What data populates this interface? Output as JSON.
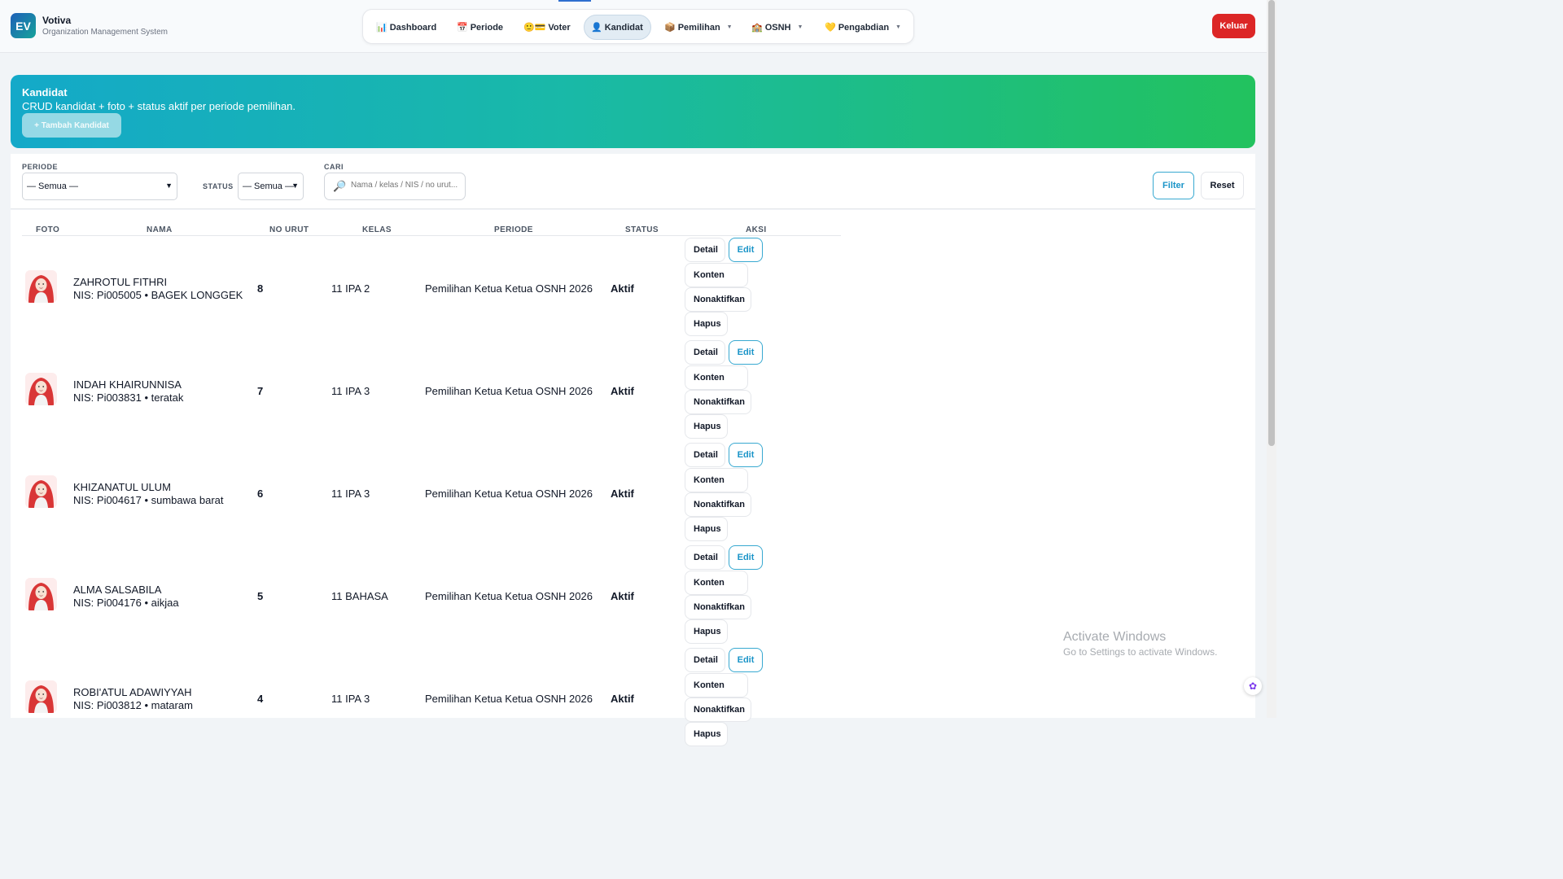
{
  "app": {
    "logo": "EV",
    "name": "Votiva",
    "subtitle": "Organization Management System"
  },
  "nav": [
    {
      "icon": "📊",
      "label": "Dashboard"
    },
    {
      "icon": "📅",
      "label": "Periode"
    },
    {
      "icon": "🙂💳",
      "label": "Voter"
    },
    {
      "icon": "👤",
      "label": "Kandidat",
      "active": true
    },
    {
      "icon": "📦",
      "label": "Pemilihan",
      "caret": "▼"
    },
    {
      "icon": "🏫",
      "label": "OSNH",
      "caret": "▼"
    },
    {
      "icon": "💛",
      "label": "Pengabdian",
      "caret": "▼"
    }
  ],
  "logout_label": "Keluar",
  "banner": {
    "title": "Kandidat",
    "subtitle": "CRUD kandidat + foto + status aktif per periode pemilihan.",
    "add_button": "+ Tambah Kandidat"
  },
  "filters": {
    "periode_label": "PERIODE",
    "periode_value": "— Semua —",
    "status_label": "STATUS",
    "status_value": "— Semua —",
    "search_label": "CARI",
    "search_placeholder": "Nama / kelas / NIS / no urut...",
    "filter_button": "Filter",
    "reset_button": "Reset"
  },
  "table": {
    "headers": [
      "FOTO",
      "NAMA",
      "NO URUT",
      "KELAS",
      "PERIODE",
      "STATUS",
      "AKSI"
    ],
    "actions": {
      "detail": "Detail",
      "edit": "Edit",
      "konten": "Konten",
      "nonaktifkan": "Nonaktifkan",
      "hapus": "Hapus"
    },
    "rows": [
      {
        "name": "ZAHROTUL FITHRI",
        "nis": "NIS: Pi005005 • BAGEK LONGGEK",
        "no": "8",
        "kelas": "11 IPA 2",
        "periode": "Pemilihan Ketua Ketua OSNH 2026",
        "status": "Aktif"
      },
      {
        "name": "INDAH KHAIRUNNISA",
        "nis": "NIS: Pi003831 • teratak",
        "no": "7",
        "kelas": "11 IPA 3",
        "periode": "Pemilihan Ketua Ketua OSNH 2026",
        "status": "Aktif"
      },
      {
        "name": "KHIZANATUL ULUM",
        "nis": "NIS: Pi004617 • sumbawa barat",
        "no": "6",
        "kelas": "11 IPA 3",
        "periode": "Pemilihan Ketua Ketua OSNH 2026",
        "status": "Aktif"
      },
      {
        "name": "ALMA SALSABILA",
        "nis": "NIS: Pi004176 • aikjaa",
        "no": "5",
        "kelas": "11 BAHASA",
        "periode": "Pemilihan Ketua Ketua OSNH 2026",
        "status": "Aktif"
      },
      {
        "name": "ROBI'ATUL ADAWIYYAH",
        "nis": "NIS: Pi003812 • mataram",
        "no": "4",
        "kelas": "11 IPA 3",
        "periode": "Pemilihan Ketua Ketua OSNH 2026",
        "status": "Aktif"
      }
    ]
  },
  "watermark": {
    "title": "Activate Windows",
    "subtitle": "Go to Settings to activate Windows."
  },
  "colors": {
    "accent": "#1a94c8",
    "logout": "#dc2626",
    "banner_start": "#14a9c9",
    "banner_end": "#22c25e"
  }
}
